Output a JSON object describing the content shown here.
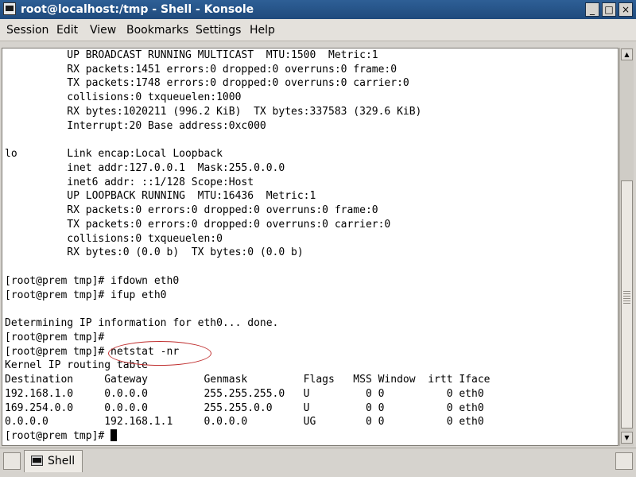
{
  "window": {
    "title": "root@localhost:/tmp - Shell - Konsole"
  },
  "titlebar_buttons": {
    "minimize": "_",
    "maximize": "□",
    "close": "×"
  },
  "menu": [
    "Session",
    "Edit",
    "View",
    "Bookmarks",
    "Settings",
    "Help"
  ],
  "terminal": {
    "lines": [
      "          UP BROADCAST RUNNING MULTICAST  MTU:1500  Metric:1",
      "          RX packets:1451 errors:0 dropped:0 overruns:0 frame:0",
      "          TX packets:1748 errors:0 dropped:0 overruns:0 carrier:0",
      "          collisions:0 txqueuelen:1000",
      "          RX bytes:1020211 (996.2 KiB)  TX bytes:337583 (329.6 KiB)",
      "          Interrupt:20 Base address:0xc000",
      "",
      "lo        Link encap:Local Loopback",
      "          inet addr:127.0.0.1  Mask:255.0.0.0",
      "          inet6 addr: ::1/128 Scope:Host",
      "          UP LOOPBACK RUNNING  MTU:16436  Metric:1",
      "          RX packets:0 errors:0 dropped:0 overruns:0 frame:0",
      "          TX packets:0 errors:0 dropped:0 overruns:0 carrier:0",
      "          collisions:0 txqueuelen:0",
      "          RX bytes:0 (0.0 b)  TX bytes:0 (0.0 b)",
      "",
      "[root@prem tmp]# ifdown eth0",
      "[root@prem tmp]# ifup eth0",
      "",
      "Determining IP information for eth0... done.",
      "[root@prem tmp]#",
      "[root@prem tmp]# netstat -nr",
      "Kernel IP routing table",
      "Destination     Gateway         Genmask         Flags   MSS Window  irtt Iface",
      "192.168.1.0     0.0.0.0         255.255.255.0   U         0 0          0 eth0",
      "169.254.0.0     0.0.0.0         255.255.0.0     U         0 0          0 eth0",
      "0.0.0.0         192.168.1.1     0.0.0.0         UG        0 0          0 eth0"
    ],
    "prompt": "[root@prem tmp]# "
  },
  "scrollbar": {
    "up_arrow": "▲",
    "down_arrow": "▼"
  },
  "taskbar": {
    "tab_label": "Shell"
  },
  "colors": {
    "titlebar": "#1f4a7c",
    "highlight_ellipse": "#c03030"
  }
}
